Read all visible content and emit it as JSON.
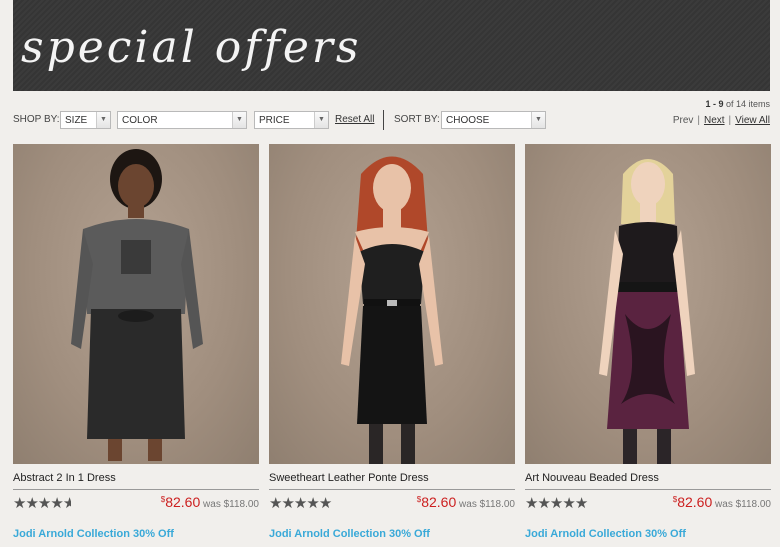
{
  "banner": {
    "title": "special offers"
  },
  "filters": {
    "shop_by_label": "SHOP BY:",
    "size": "SIZE",
    "color": "COLOR",
    "price": "PRICE",
    "reset_label": "Reset All",
    "sort_by_label": "SORT BY:",
    "sort": "CHOOSE"
  },
  "pager": {
    "range": "1 - 9",
    "of_text": "of 14 items",
    "prev": "Prev",
    "next": "Next",
    "view_all": "View All"
  },
  "products": [
    {
      "name": "Abstract 2 In 1 Dress",
      "currency": "$",
      "sale_price": "82.60",
      "was_label": "was $118.00",
      "rating": 4.5,
      "promo": "Jodi Arnold Collection 30% Off"
    },
    {
      "name": "Sweetheart Leather Ponte Dress",
      "currency": "$",
      "sale_price": "82.60",
      "was_label": "was $118.00",
      "rating": 5,
      "promo": "Jodi Arnold Collection 30% Off"
    },
    {
      "name": "Art Nouveau Beaded Dress",
      "currency": "$",
      "sale_price": "82.60",
      "was_label": "was $118.00",
      "rating": 5,
      "promo": "Jodi Arnold Collection 30% Off"
    }
  ],
  "icons": {
    "star": "★",
    "arrow": "▼"
  },
  "colors": {
    "sale": "#cc1f1f",
    "promo": "#39a9d8"
  }
}
